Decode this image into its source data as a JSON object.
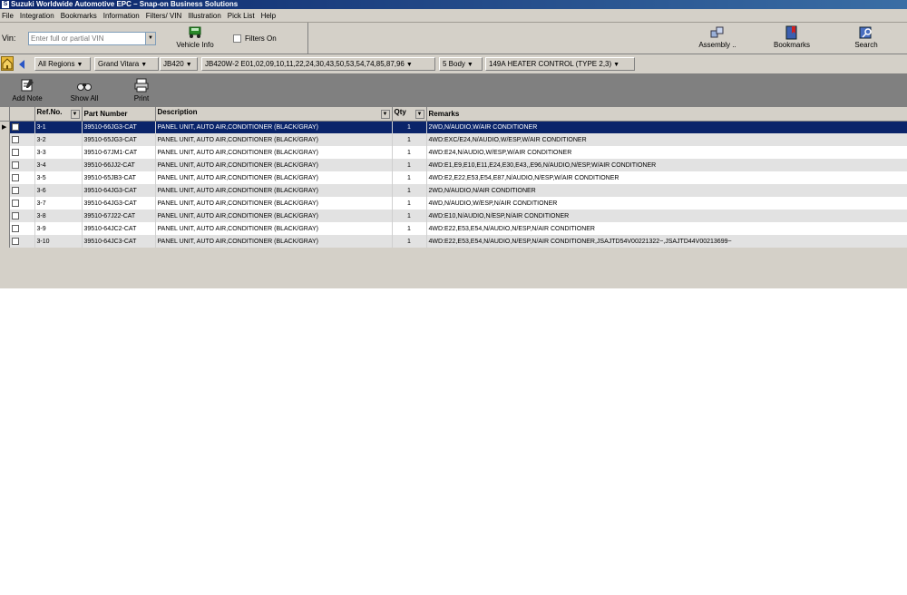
{
  "window": {
    "title": "Suzuki Worldwide Automotive EPC – Snap-on Business Solutions"
  },
  "menu": [
    "File",
    "Integration",
    "Bookmarks",
    "Information",
    "Filters/ VIN",
    "Illustration",
    "Pick List",
    "Help"
  ],
  "vin": {
    "label": "Vin:",
    "placeholder": "Enter full or partial VIN"
  },
  "toolbar": {
    "vehicle_info": "Vehicle Info",
    "filters_on": "Filters On",
    "assembly": "Assembly ..",
    "bookmarks": "Bookmarks",
    "search": "Search"
  },
  "breadcrumb": {
    "regions": "All Regions",
    "model": "Grand Vitara",
    "code": "JB420",
    "variant": "JB420W-2  E01,02,09,10,11,22,24,30,43,50,53,54,74,85,87,96",
    "body": "5 Body",
    "section": "149A HEATER CONTROL (TYPE 2,3)"
  },
  "actions": {
    "add_note": "Add Note",
    "show_all": "Show All",
    "print": "Print"
  },
  "table": {
    "columns": [
      "Ref.No.",
      "Part Number",
      "Description",
      "Qty",
      "Remarks"
    ],
    "rows": [
      {
        "ref": "3-1",
        "part": "39510-66JG3-CAT",
        "desc": "PANEL  UNIT,  AUTO  AIR,CONDITIONER  (BLACK/GRAY)",
        "qty": "1",
        "remarks": "2WD,N/AUDIO,W/AIR  CONDITIONER"
      },
      {
        "ref": "3-2",
        "part": "39510-65JG3-CAT",
        "desc": "PANEL  UNIT,  AUTO  AIR,CONDITIONER  (BLACK/GRAY)",
        "qty": "1",
        "remarks": "4WD:EXC/E24,N/AUDIO,W/ESP,W/AIR  CONDITIONER"
      },
      {
        "ref": "3-3",
        "part": "39510-67JM1-CAT",
        "desc": "PANEL  UNIT,  AUTO  AIR,CONDITIONER  (BLACK/GRAY)",
        "qty": "1",
        "remarks": "4WD:E24,N/AUDIO,W/ESP,W/AIR  CONDITIONER"
      },
      {
        "ref": "3-4",
        "part": "39510-66JJ2-CAT",
        "desc": "PANEL  UNIT,  AUTO  AIR,CONDITIONER  (BLACK/GRAY)",
        "qty": "1",
        "remarks": "4WD:E1,E9,E10,E11,E24,E30,E43,,E96,N/AUDIO,N/ESP,W/AIR  CONDITIONER"
      },
      {
        "ref": "3-5",
        "part": "39510-65JB3-CAT",
        "desc": "PANEL  UNIT,  AUTO  AIR,CONDITIONER  (BLACK/GRAY)",
        "qty": "1",
        "remarks": "4WD:E2,E22,E53,E54,E87,N/AUDIO,N/ESP,W/AIR  CONDITIONER"
      },
      {
        "ref": "3-6",
        "part": "39510-64JG3-CAT",
        "desc": "PANEL  UNIT,  AUTO  AIR,CONDITIONER  (BLACK/GRAY)",
        "qty": "1",
        "remarks": "2WD,N/AUDIO,N/AIR  CONDITIONER"
      },
      {
        "ref": "3-7",
        "part": "39510-64JG3-CAT",
        "desc": "PANEL  UNIT,  AUTO  AIR,CONDITIONER  (BLACK/GRAY)",
        "qty": "1",
        "remarks": "4WD,N/AUDIO,W/ESP,N/AIR  CONDITIONER"
      },
      {
        "ref": "3-8",
        "part": "39510-67J22-CAT",
        "desc": "PANEL  UNIT,  AUTO  AIR,CONDITIONER  (BLACK/GRAY)",
        "qty": "1",
        "remarks": "4WD:E10,N/AUDIO,N/ESP,N/AIR  CONDITIONER"
      },
      {
        "ref": "3-9",
        "part": "39510-64JC2-CAT",
        "desc": "PANEL  UNIT,  AUTO  AIR,CONDITIONER  (BLACK/GRAY)",
        "qty": "1",
        "remarks": "4WD:E22,E53,E54,N/AUDIO,N/ESP,N/AIR  CONDITIONER"
      },
      {
        "ref": "3-10",
        "part": "39510-64JC3-CAT",
        "desc": "PANEL  UNIT,  AUTO  AIR,CONDITIONER  (BLACK/GRAY)",
        "qty": "1",
        "remarks": "4WD:E22,E53,E54,N/AUDIO,N/ESP,N/AIR  CONDITIONER,JSAJTD54V00221322~,JSAJTD44V00213699~"
      }
    ],
    "selected_index": 0
  },
  "colors": {
    "title_bar": "#0a246a",
    "selection": "#0a246a",
    "chrome": "#d4d0c8",
    "toolbar_bg": "#808080"
  }
}
